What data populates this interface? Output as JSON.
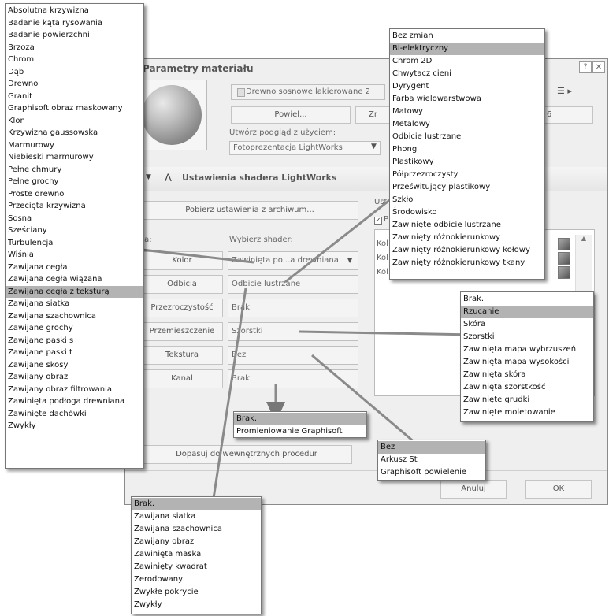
{
  "dialog": {
    "title": "Parametry materiału",
    "material_name": "Drewno sosnowe lakierowane 2",
    "duplicate_button": "Powiel...",
    "rename_button_partial": "Zr",
    "right_button_partial": "6",
    "preview_label": "Utwórz podgląd z użyciem:",
    "preview_engine": "Fotoprezentacja LightWorks",
    "section_title": "Ustawienia shadera LightWorks",
    "load_archive_button": "Pobierz ustawienia z archiwum...",
    "class_label": "lasa:",
    "shader_label": "Wybierz shader:",
    "right_section_partial": "Ust",
    "checkbox_partial": "P",
    "right_rows_partial": [
      "Kol",
      "Kol",
      "Kol"
    ],
    "rows": [
      {
        "button": "Kolor",
        "value": "Zawinięta po...a drewniana",
        "dropdown": true
      },
      {
        "button": "Odbicia",
        "value": "Odbicie lustrzane",
        "dropdown": false
      },
      {
        "button": "Przezroczystość",
        "value": "Brak.",
        "dropdown": false
      },
      {
        "button": "Przemieszczenie",
        "value": "Szorstki",
        "dropdown": false
      },
      {
        "button": "Tekstura",
        "value": "Bez",
        "dropdown": false
      },
      {
        "button": "Kanał",
        "value": "Brak.",
        "dropdown": false
      }
    ],
    "fit_button": "Dopasuj do wewnętrznych procedur",
    "cancel_button": "Anuluj",
    "ok_button": "OK"
  },
  "color_list": {
    "items": [
      "Absolutna krzywizna",
      "Badanie kąta rysowania",
      "Badanie powierzchni",
      "Brzoza",
      "Chrom",
      "Dąb",
      "Drewno",
      "Granit",
      "Graphisoft obraz maskowany",
      "Klon",
      "Krzywizna gaussowska",
      "Marmurowy",
      "Niebieski marmurowy",
      "Pełne chmury",
      "Pełne grochy",
      "Proste drewno",
      "Przecięta krzywizna",
      "Sosna",
      "Sześciany",
      "Turbulencja",
      "Wiśnia",
      "Zawijana cegła",
      "Zawijana cegła wiązana",
      "Zawijana cegła z teksturą",
      "Zawijana siatka",
      "Zawijana szachownica",
      "Zawijane grochy",
      "Zawijane paski s",
      "Zawijane paski t",
      "Zawijane skosy",
      "Zawijany obraz",
      "Zawijany obraz filtrowania",
      "Zawinięta podłoga drewniana",
      "Zawinięte dachówki",
      "Zwykły"
    ],
    "selected_index": 23
  },
  "reflection_list": {
    "items": [
      "Bez zmian",
      "Bi-elektryczny",
      "Chrom 2D",
      "Chwytacz cieni",
      "Dyrygent",
      "Farba wielowarstwowa",
      "Matowy",
      "Metalowy",
      "Odbicie lustrzane",
      "Phong",
      "Plastikowy",
      "Półprzezroczysty",
      "Prześwitujący plastikowy",
      "Szkło",
      "Środowisko",
      "Zawinięte odbicie lustrzane",
      "Zawinięty różnokierunkowy",
      "Zawinięty różnokierunkowy kołowy",
      "Zawinięty różnokierunkowy tkany"
    ],
    "selected_index": 1
  },
  "displacement_list": {
    "items": [
      "Brak.",
      "Rzucanie",
      "Skóra",
      "Szorstki",
      "Zawinięta mapa wybrzuszeń",
      "Zawinięta mapa wysokości",
      "Zawinięta skóra",
      "Zawinięta szorstkość",
      "Zawinięte grudki",
      "Zawinięte moletowanie"
    ],
    "selected_index": 1
  },
  "channel_list": {
    "items": [
      "Brak.",
      "Promieniowanie Graphisoft"
    ],
    "selected_index": 0
  },
  "texture_list": {
    "items": [
      "Bez",
      "Arkusz St",
      "Graphisoft powielenie"
    ],
    "selected_index": 0
  },
  "transparency_list": {
    "items": [
      "Brak.",
      "Zawijana siatka",
      "Zawijana szachownica",
      "Zawijany obraz",
      "Zawinięta maska",
      "Zawinięty kwadrat",
      "Zerodowany",
      "Zwykłe pokrycie",
      "Zwykły"
    ],
    "selected_index": 0
  }
}
